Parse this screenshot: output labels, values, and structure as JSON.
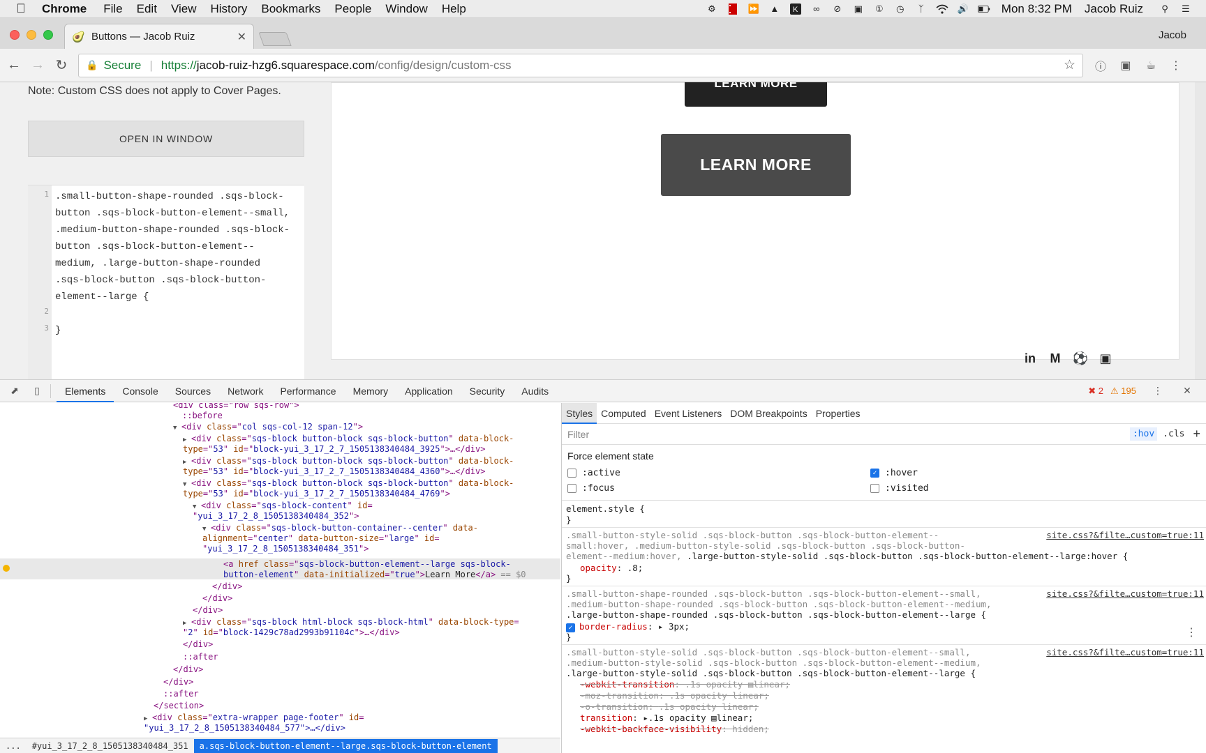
{
  "menubar": {
    "app": "Chrome",
    "items": [
      "File",
      "Edit",
      "View",
      "History",
      "Bookmarks",
      "People",
      "Window",
      "Help"
    ],
    "clock": "Mon 8:32 PM",
    "user": "Jacob Ruiz"
  },
  "tab": {
    "title": "Buttons — Jacob Ruiz",
    "profile": "Jacob"
  },
  "omnibox": {
    "secure_label": "Secure",
    "scheme": "https://",
    "host": "jacob-ruiz-hzg6.squarespace.com",
    "path": "/config/design/custom-css"
  },
  "page": {
    "note": "Note: Custom CSS does not apply to Cover Pages.",
    "open_window": "OPEN IN WINDOW",
    "editor": {
      "line_numbers": [
        "1",
        "2",
        "3"
      ],
      "lines": [
        ".small-button-shape-rounded .sqs-block-",
        "button .sqs-block-button-element--small,",
        ".medium-button-shape-rounded .sqs-block-",
        "button .sqs-block-button-element--",
        "medium, .large-button-shape-rounded",
        ".sqs-block-button .sqs-block-button-",
        "element--large {",
        "}"
      ]
    },
    "preview": {
      "button_top": "LEARN MORE",
      "button_main": "LEARN MORE"
    }
  },
  "devtools": {
    "tabs": [
      "Elements",
      "Console",
      "Sources",
      "Network",
      "Performance",
      "Memory",
      "Application",
      "Security",
      "Audits"
    ],
    "errors": "2",
    "warnings": "195",
    "elements": {
      "l1": "<div class=\"row sqs-row\">",
      "l2": "::before",
      "l3": [
        "<div ",
        "class",
        "=\"",
        "col sqs-col-12 span-12",
        "\">"
      ],
      "l4a": [
        "<div ",
        "class",
        "=\"",
        "sqs-block button-block sqs-block-button",
        "\" ",
        "data-block-"
      ],
      "l4b": [
        "type",
        "=\"",
        "53",
        "\" ",
        "id",
        "=\"",
        "block-yui_3_17_2_7_1505138340484_3925",
        "\">…</div>"
      ],
      "l5a": [
        "<div ",
        "class",
        "=\"",
        "sqs-block button-block sqs-block-button",
        "\" ",
        "data-block-"
      ],
      "l5b": [
        "type",
        "=\"",
        "53",
        "\" ",
        "id",
        "=\"",
        "block-yui_3_17_2_7_1505138340484_4360",
        "\">…</div>"
      ],
      "l6a": [
        "<div ",
        "class",
        "=\"",
        "sqs-block button-block sqs-block-button",
        "\" ",
        "data-block-"
      ],
      "l6b": [
        "type",
        "=\"",
        "53",
        "\" ",
        "id",
        "=\"",
        "block-yui_3_17_2_7_1505138340484_4769",
        "\">"
      ],
      "l7a": [
        "<div ",
        "class",
        "=\"",
        "sqs-block-content",
        "\" ",
        "id",
        "="
      ],
      "l7b": [
        "\"",
        "yui_3_17_2_8_1505138340484_352",
        "\">"
      ],
      "l8a": [
        "<div ",
        "class",
        "=\"",
        "sqs-block-button-container--center",
        "\" ",
        "data-"
      ],
      "l8b": [
        "alignment",
        "=\"",
        "center",
        "\" ",
        "data-button-size",
        "=\"",
        "large",
        "\" ",
        "id",
        "="
      ],
      "l8c": [
        "\"",
        "yui_3_17_2_8_1505138340484_351",
        "\">"
      ],
      "l9a": [
        "<a ",
        "href ",
        "class",
        "=\"",
        "sqs-block-button-element--large sqs-block-"
      ],
      "l9b": [
        "button-element",
        "\" ",
        "data-initialized",
        "=\"",
        "true",
        "\">",
        "Learn More",
        "</a>",
        " == $0"
      ],
      "l10": "</div>",
      "l11": "</div>",
      "l12": "</div>",
      "l13a": [
        "<div ",
        "class",
        "=\"",
        "sqs-block html-block sqs-block-html",
        "\" ",
        "data-block-type",
        "="
      ],
      "l13b": [
        "\"",
        "2",
        "\" ",
        "id",
        "=\"",
        "block-1429c78ad2993b91104c",
        "\">…</div>"
      ],
      "l14": "</div>",
      "l15": "::after",
      "l16": "</div>",
      "l17": "</div>",
      "l18": "::after",
      "l19": "</section>",
      "l20a": [
        "<div ",
        "class",
        "=\"",
        "extra-wrapper page-footer",
        "\" ",
        "id",
        "="
      ],
      "l20b": [
        "\"yui_3_17_2_8_1505138340484_577\">…</div>"
      ]
    },
    "breadcrumb": [
      "...",
      "#yui_3_17_2_8_1505138340484_351",
      "a.sqs-block-button-element--large.sqs-block-button-element"
    ],
    "styles": {
      "tabs": [
        "Styles",
        "Computed",
        "Event Listeners",
        "DOM Breakpoints",
        "Properties"
      ],
      "filter_placeholder": "Filter",
      "hov": ":hov",
      "cls": ".cls",
      "plus": "+",
      "force_heading": "Force element state",
      "states": [
        {
          "label": ":active",
          "checked": false
        },
        {
          "label": ":hover",
          "checked": true
        },
        {
          "label": ":focus",
          "checked": false
        },
        {
          "label": ":visited",
          "checked": false
        }
      ],
      "element_style": "element.style {",
      "close_brace": "}",
      "rule1": {
        "sel1": ".small-button-style-solid .sqs-block-button .sqs-block-button-element--",
        "sel2": "small:hover, .medium-button-style-solid .sqs-block-button .sqs-block-button-",
        "sel3a": "element--medium:hover, ",
        "sel3b": ".large-button-style-solid .sqs-block-button .sqs-block-button-element--large:hover {",
        "prop": "opacity",
        "val": ".8;",
        "source": "site.css?&filte…custom=true:11"
      },
      "rule2": {
        "sel1": ".small-button-shape-rounded .sqs-block-button .sqs-block-button-element--small,",
        "sel2": ".medium-button-shape-rounded .sqs-block-button .sqs-block-button-element--medium,",
        "sel3": ".large-button-shape-rounded .sqs-block-button .sqs-block-button-element--large {",
        "prop": "border-radius",
        "val": "3px;",
        "source": "site.css?&filte…custom=true:11"
      },
      "rule3": {
        "sel1": ".small-button-style-solid .sqs-block-button .sqs-block-button-element--small,",
        "sel2": ".medium-button-style-solid .sqs-block-button .sqs-block-button-element--medium,",
        "sel3": ".large-button-style-solid .sqs-block-button .sqs-block-button-element--large {",
        "d1p": "-webkit-transition",
        "d1v": ".1s opacity ",
        "d1v2": "linear;",
        "d2p": "-moz-transition",
        "d2v": ".1s opacity linear;",
        "d3p": "-o-transition",
        "d3v": ".1s opacity linear;",
        "d4p": "transition",
        "d4v": ".1s opacity ",
        "d4v2": "linear;",
        "d5p": "-webkit-backface-visibility",
        "d5v": "hidden;",
        "source": "site.css?&filte…custom=true:11"
      }
    }
  }
}
